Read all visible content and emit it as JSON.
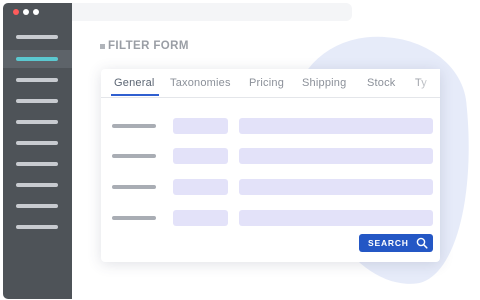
{
  "window": {
    "dot_colors": [
      "#ff5b5b",
      "#ffffff",
      "#ffffff"
    ]
  },
  "page": {
    "title": "FILTER FORM"
  },
  "tabs": [
    {
      "label": "General",
      "active": true
    },
    {
      "label": "Taxonomies",
      "active": false
    },
    {
      "label": "Pricing",
      "active": false
    },
    {
      "label": "Shipping",
      "active": false
    },
    {
      "label": "Stock",
      "active": false
    },
    {
      "label": "Ty",
      "active": false
    }
  ],
  "actions": {
    "search_label": "SEARCH"
  },
  "colors": {
    "accent": "#2457c5",
    "sidebar": "#4e5358",
    "active_sidebar_item": "#5bc8d0",
    "field_placeholder": "#e3e2f9"
  },
  "icons": {
    "search": "search-icon"
  }
}
